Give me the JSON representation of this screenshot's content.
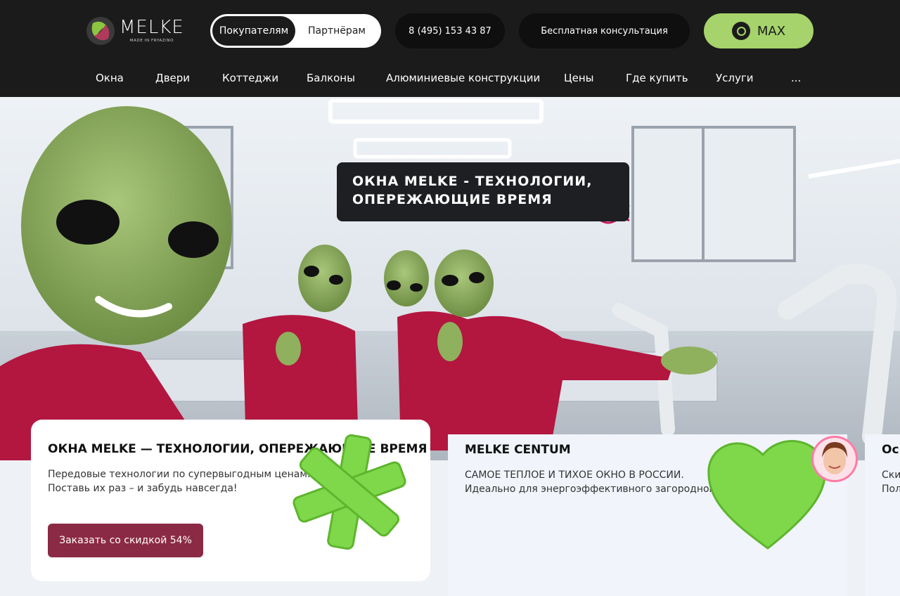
{
  "header": {
    "logo": {
      "word": "MELKE",
      "sub": "MADE IN FRYAZINO"
    },
    "audience_toggle": [
      {
        "label": "Покупателям",
        "active": true
      },
      {
        "label": "Партнёрам",
        "active": false
      }
    ],
    "phone": "8 (495) 153 43 87",
    "consult_label": "Бесплатная консультация",
    "max_label": "MAX",
    "colors": {
      "background": "#1b1b1b",
      "accent_green": "#a6d36b"
    }
  },
  "nav": [
    "Окна",
    "Двери",
    "Коттеджи",
    "Балконы",
    "Алюминиевые конструкции",
    "Цены",
    "Где купить",
    "Услуги",
    "..."
  ],
  "hero": {
    "badge_line1": "ОКНА MELKE - ТЕХНОЛОГИИ,",
    "badge_line2": "ОПЕРЕЖАЮЩИЕ ВРЕМЯ"
  },
  "cards": [
    {
      "title": "ОКНА MELKE — ТЕХНОЛОГИИ, ОПЕРЕЖАЮЩИЕ ВРЕМЯ",
      "line1": "Передовые технологии по супервыгодным ценам.",
      "line2": "Поставь их раз – и забудь навсегда!",
      "button": "Заказать со скидкой 54%"
    },
    {
      "title": "MELKE CENTUM",
      "line1": "САМОЕ ТЕПЛОЕ И ТИХОЕ ОКНО В РОССИИ.",
      "line2": "Идеально для энергоэффективного загородного строительства."
    },
    {
      "title": "Ос",
      "line1": "Ски",
      "line2": "Пол"
    }
  ],
  "colors": {
    "button_primary": "#8b2a44",
    "shape_green": "#7fd84a"
  }
}
